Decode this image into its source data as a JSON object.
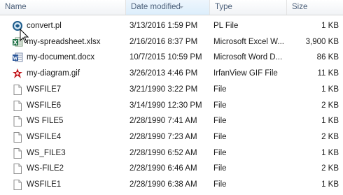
{
  "columns": {
    "name": "Name",
    "date": "Date modified",
    "type": "Type",
    "size": "Size"
  },
  "files": [
    {
      "name": "convert.pl",
      "date": "3/13/2016 1:59 PM",
      "type": "PL File",
      "size": "1 KB",
      "icon": "perl-file-icon"
    },
    {
      "name": "my-spreadsheet.xlsx",
      "date": "2/16/2016 8:37 PM",
      "type": "Microsoft Excel W...",
      "size": "3,900 KB",
      "icon": "excel-file-icon"
    },
    {
      "name": "my-document.docx",
      "date": "10/7/2015 10:59 PM",
      "type": "Microsoft Word D...",
      "size": "86 KB",
      "icon": "word-file-icon"
    },
    {
      "name": "my-diagram.gif",
      "date": "3/26/2013 4:46 PM",
      "type": "IrfanView GIF File",
      "size": "11 KB",
      "icon": "irfanview-file-icon"
    },
    {
      "name": "WSFILE7",
      "date": "3/21/1990 3:22 PM",
      "type": "File",
      "size": "1 KB",
      "icon": "blank-file-icon"
    },
    {
      "name": "WSFILE6",
      "date": "3/14/1990 12:30 PM",
      "type": "File",
      "size": "2 KB",
      "icon": "blank-file-icon"
    },
    {
      "name": "WS FILE5",
      "date": "2/28/1990 7:41 AM",
      "type": "File",
      "size": "1 KB",
      "icon": "blank-file-icon"
    },
    {
      "name": "WSFILE4",
      "date": "2/28/1990 7:23 AM",
      "type": "File",
      "size": "2 KB",
      "icon": "blank-file-icon"
    },
    {
      "name": "WS_FILE3",
      "date": "2/28/1990 6:52 AM",
      "type": "File",
      "size": "1 KB",
      "icon": "blank-file-icon"
    },
    {
      "name": "WS-FILE2",
      "date": "2/28/1990 6:46 AM",
      "type": "File",
      "size": "2 KB",
      "icon": "blank-file-icon"
    },
    {
      "name": "WSFILE1",
      "date": "2/28/1990 6:38 AM",
      "type": "File",
      "size": "1 KB",
      "icon": "blank-file-icon"
    }
  ]
}
